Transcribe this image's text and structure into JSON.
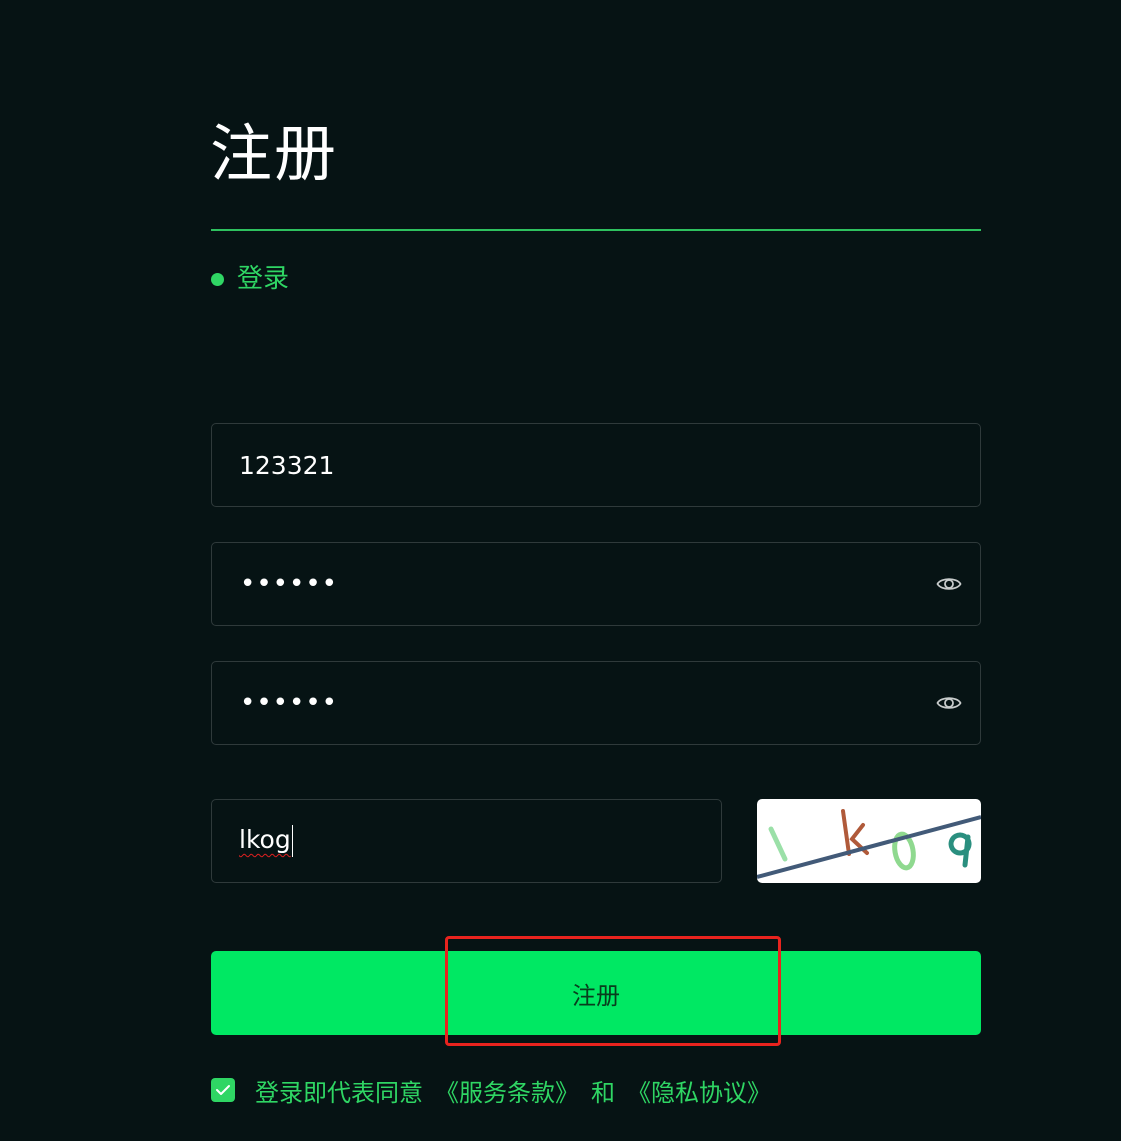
{
  "title": "注册",
  "switch_link": {
    "label": "登录"
  },
  "form": {
    "username": {
      "value": "123321"
    },
    "password": {
      "masked": "••••••"
    },
    "confirm_password": {
      "masked": "••••••"
    },
    "captcha": {
      "value": "lkog",
      "image_text": "1k0g"
    }
  },
  "submit": {
    "label": "注册"
  },
  "agreement": {
    "checked": true,
    "prefix": "登录即代表同意",
    "terms_label": "《服务条款》",
    "conjunction": "和",
    "privacy_label": "《隐私协议》"
  },
  "colors": {
    "background": "#061314",
    "accent": "#2fd664",
    "button": "#00e863",
    "highlight": "#e8231e"
  }
}
